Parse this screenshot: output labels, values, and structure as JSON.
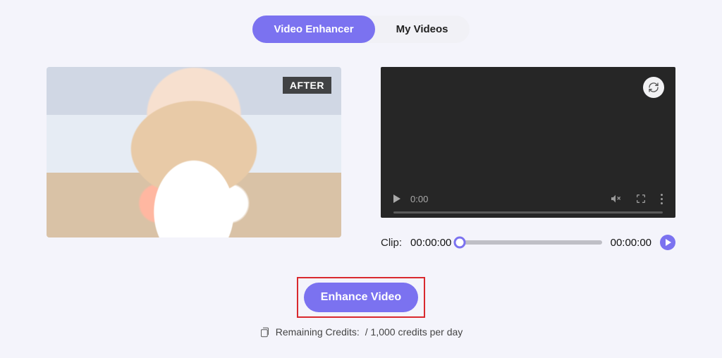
{
  "tabs": {
    "enhancer": "Video Enhancer",
    "myvideos": "My Videos"
  },
  "sample": {
    "badge": "AFTER"
  },
  "player": {
    "time": "0:00"
  },
  "clip": {
    "label": "Clip:",
    "start": "00:00:00",
    "end": "00:00:00"
  },
  "actions": {
    "enhance": "Enhance Video"
  },
  "credits": {
    "label": "Remaining Credits:",
    "rate": "/ 1,000 credits per day"
  }
}
